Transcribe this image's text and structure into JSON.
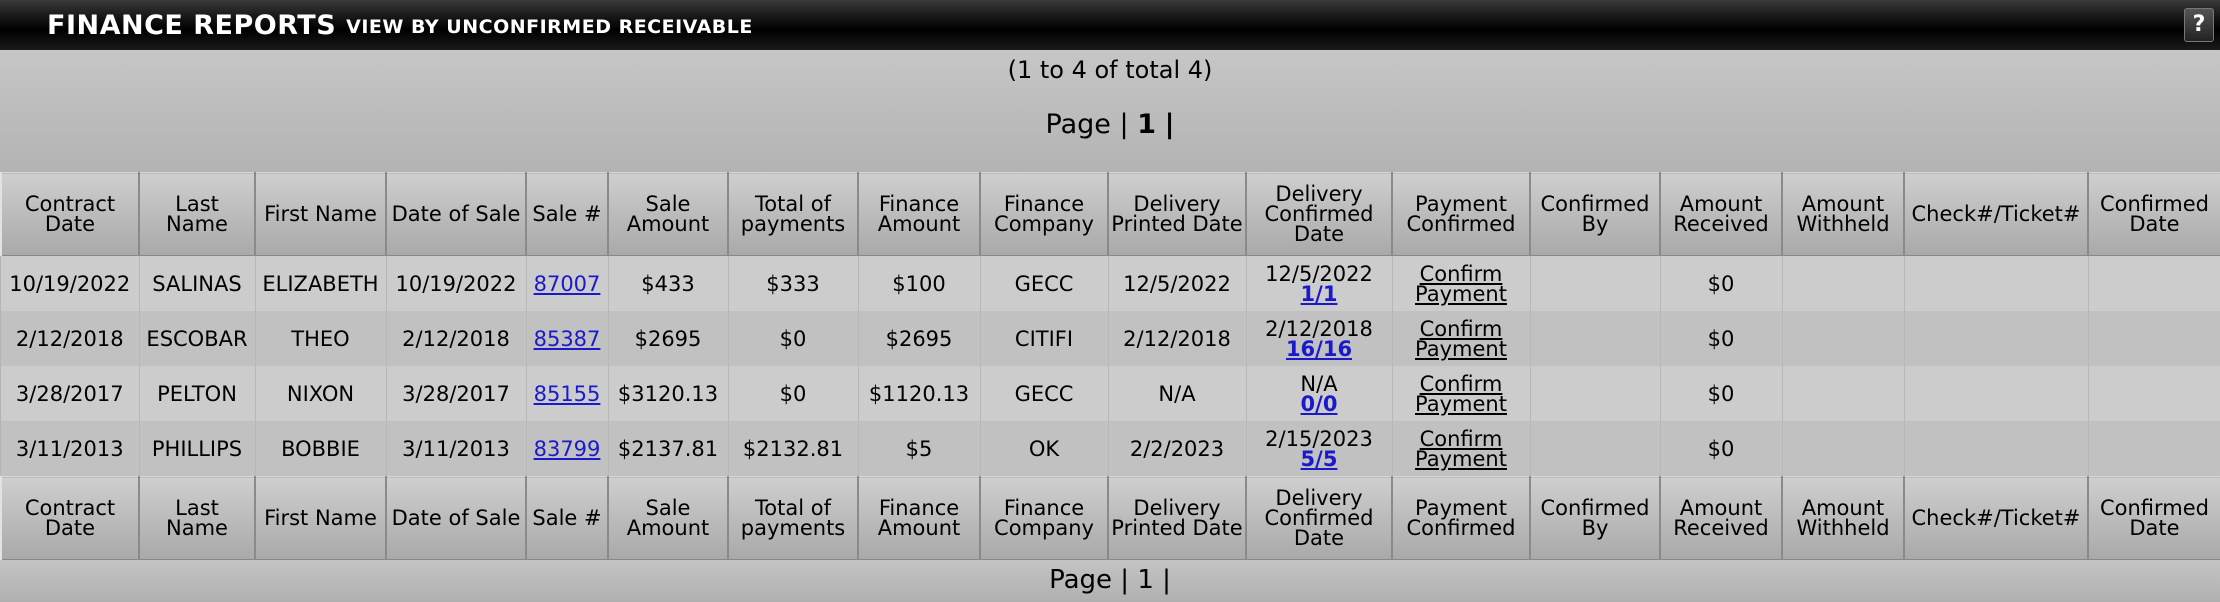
{
  "header": {
    "title": "FINANCE REPORTS",
    "subtitle": "VIEW BY UNCONFIRMED RECEIVABLE",
    "help_label": "?"
  },
  "summary": {
    "range_text": "(1 to 4 of total 4)",
    "page_label": "Page",
    "separator": "|",
    "current_page": "1",
    "trailing_separator": "|"
  },
  "columns": [
    "Contract Date",
    "Last Name",
    "First Name",
    "Date of Sale",
    "Sale #",
    "Sale Amount",
    "Total of payments",
    "Finance Amount",
    "Finance Company",
    "Delivery Printed Date",
    "Delivery Confirmed Date",
    "Payment Confirmed",
    "Confirmed By",
    "Amount Received",
    "Amount Withheld",
    "Check#/Ticket#",
    "Confirmed Date"
  ],
  "rows": [
    {
      "contract_date": "10/19/2022",
      "last_name": "SALINAS",
      "first_name": "ELIZABETH",
      "date_of_sale": "10/19/2022",
      "sale_no": "87007",
      "sale_amount": "$433",
      "total_payments": "$333",
      "finance_amount": "$100",
      "finance_company": "GECC",
      "delivery_printed": "12/5/2022",
      "delivery_confirmed": "12/5/2022",
      "delivery_ratio": "1/1",
      "payment_confirmed_line1": "Confirm",
      "payment_confirmed_line2": "Payment",
      "confirmed_by": "",
      "amount_received": "$0",
      "amount_withheld": "",
      "check_ticket": "",
      "confirmed_date": ""
    },
    {
      "contract_date": "2/12/2018",
      "last_name": "ESCOBAR",
      "first_name": "THEO",
      "date_of_sale": "2/12/2018",
      "sale_no": "85387",
      "sale_amount": "$2695",
      "total_payments": "$0",
      "finance_amount": "$2695",
      "finance_company": "CITIFI",
      "delivery_printed": "2/12/2018",
      "delivery_confirmed": "2/12/2018",
      "delivery_ratio": "16/16",
      "payment_confirmed_line1": "Confirm",
      "payment_confirmed_line2": "Payment",
      "confirmed_by": "",
      "amount_received": "$0",
      "amount_withheld": "",
      "check_ticket": "",
      "confirmed_date": ""
    },
    {
      "contract_date": "3/28/2017",
      "last_name": "PELTON",
      "first_name": "NIXON",
      "date_of_sale": "3/28/2017",
      "sale_no": "85155",
      "sale_amount": "$3120.13",
      "total_payments": "$0",
      "finance_amount": "$1120.13",
      "finance_company": "GECC",
      "delivery_printed": "N/A",
      "delivery_confirmed": "N/A",
      "delivery_ratio": "0/0",
      "payment_confirmed_line1": "Confirm",
      "payment_confirmed_line2": "Payment",
      "confirmed_by": "",
      "amount_received": "$0",
      "amount_withheld": "",
      "check_ticket": "",
      "confirmed_date": ""
    },
    {
      "contract_date": "3/11/2013",
      "last_name": "PHILLIPS",
      "first_name": "BOBBIE",
      "date_of_sale": "3/11/2013",
      "sale_no": "83799",
      "sale_amount": "$2137.81",
      "total_payments": "$2132.81",
      "finance_amount": "$5",
      "finance_company": "OK",
      "delivery_printed": "2/2/2023",
      "delivery_confirmed": "2/15/2023",
      "delivery_ratio": "5/5",
      "payment_confirmed_line1": "Confirm",
      "payment_confirmed_line2": "Payment",
      "confirmed_by": "",
      "amount_received": "$0",
      "amount_withheld": "",
      "check_ticket": "",
      "confirmed_date": ""
    }
  ],
  "footer": {
    "page_text": "Page | 1 |"
  }
}
